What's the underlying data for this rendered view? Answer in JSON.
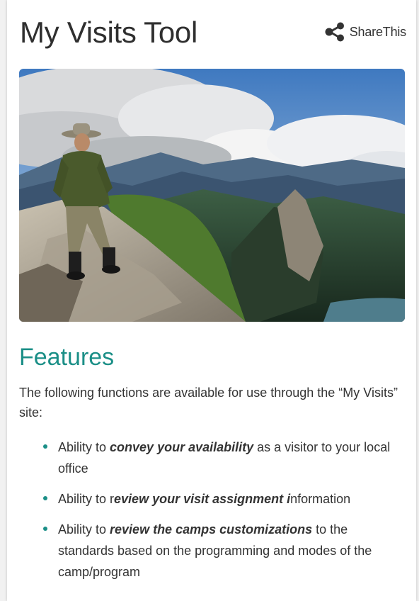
{
  "header": {
    "title": "My Visits Tool",
    "share_label": "ShareThis"
  },
  "hero": {
    "alt": "Hiker in a wide-brim hat standing on a rocky summit above a mountain valley under clouds"
  },
  "features": {
    "heading": "Features",
    "intro": "The following functions are available for use through the “My Visits” site:",
    "items": [
      {
        "pre": "Ability to ",
        "em": "convey your availability",
        "post": " as a visitor to your local office"
      },
      {
        "pre": "Ability to r",
        "em": "eview your visit assignment i",
        "post": "nformation"
      },
      {
        "pre": "Ability to ",
        "em": "review the camps customizations",
        "post": " to the standards based on the programming and modes of the camp/program"
      }
    ]
  },
  "colors": {
    "accent": "#1b8f87",
    "text": "#333333",
    "card_bg": "#ffffff",
    "page_bg": "#f1f1f1"
  },
  "icons": {
    "share": "share-icon"
  }
}
